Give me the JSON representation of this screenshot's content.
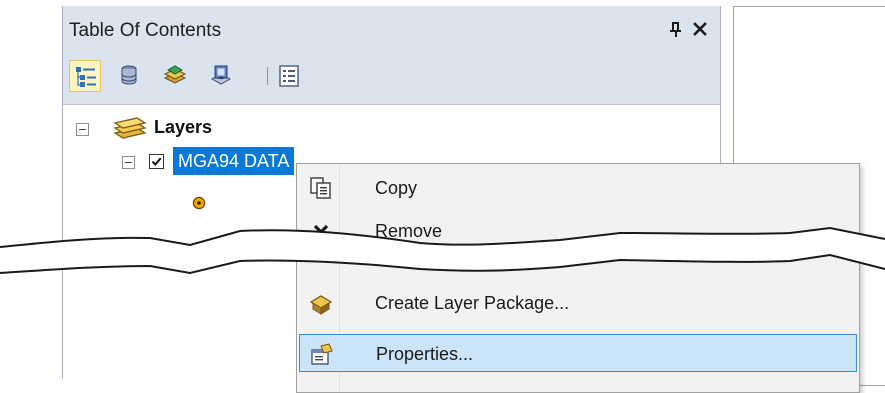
{
  "toc": {
    "title": "Table Of Contents",
    "pin_icon": "pin-icon",
    "close_icon": "close-icon",
    "toolbar": [
      {
        "name": "list-by-drawing-order",
        "icon": "list-by-drawing-order-icon",
        "selected": true
      },
      {
        "name": "list-by-source",
        "icon": "list-by-source-icon",
        "selected": false
      },
      {
        "name": "list-by-visibility",
        "icon": "list-by-visibility-icon",
        "selected": false
      },
      {
        "name": "list-by-selection",
        "icon": "list-by-selection-icon",
        "selected": false
      },
      {
        "name": "options",
        "icon": "options-icon",
        "selected": false
      }
    ],
    "tree": {
      "root_label": "Layers",
      "layer_name": "MGA94 DATA",
      "layer_checked": true,
      "symbol_color": "#f5a300"
    }
  },
  "context_menu": {
    "items": [
      {
        "label": "Copy",
        "icon": "copy-icon"
      },
      {
        "label": "Remove",
        "icon": "remove-icon"
      },
      {
        "label": "Create Layer Package...",
        "icon": "layer-package-icon"
      },
      {
        "label": "Properties...",
        "icon": "properties-icon",
        "highlighted": true
      }
    ]
  },
  "colors": {
    "selection": "#0a78d7",
    "menu_highlight": "#cce4f7",
    "pane_header": "#dbe3ef"
  }
}
